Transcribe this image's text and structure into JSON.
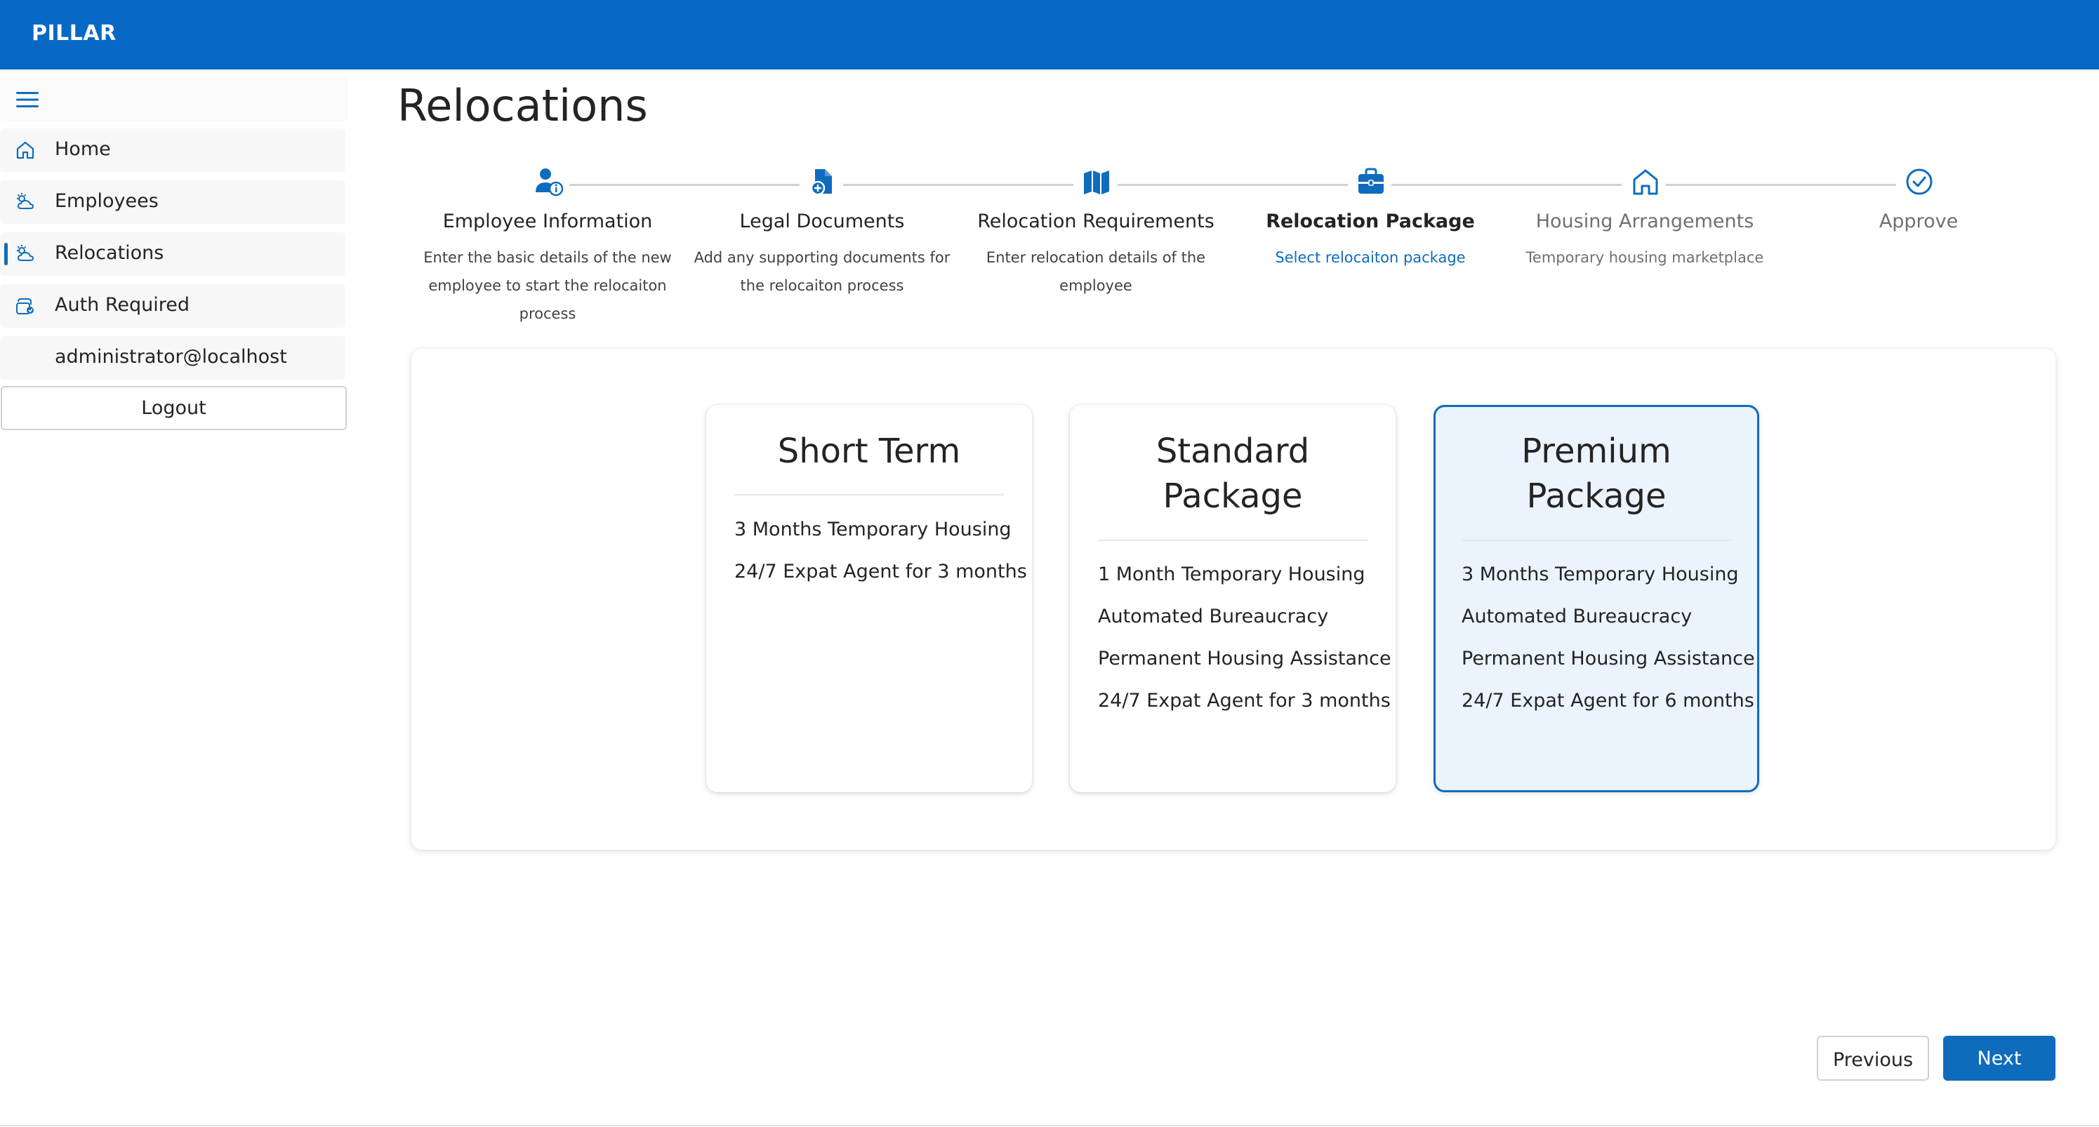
{
  "app": {
    "brand": "PILLAR"
  },
  "sidebar": {
    "items": [
      {
        "label": "Home",
        "icon": "home-icon"
      },
      {
        "label": "Employees",
        "icon": "weather-icon"
      },
      {
        "label": "Relocations",
        "icon": "weather-icon",
        "active": true
      },
      {
        "label": "Auth Required",
        "icon": "auth-icon"
      },
      {
        "label": "administrator@localhost"
      }
    ],
    "logout_label": "Logout"
  },
  "page": {
    "title": "Relocations"
  },
  "stepper": {
    "steps": [
      {
        "title": "Employee Information",
        "desc": "Enter the basic details of the new employee to start the relocaiton process",
        "icon": "person-info-icon",
        "state": "done"
      },
      {
        "title": "Legal Documents",
        "desc": "Add any supporting documents for the relocaiton process",
        "icon": "document-add-icon",
        "state": "done"
      },
      {
        "title": "Relocation Requirements",
        "desc": "Enter relocation details of the employee",
        "icon": "map-icon",
        "state": "done"
      },
      {
        "title": "Relocation Package",
        "desc": "Select relocaiton package",
        "icon": "briefcase-icon",
        "state": "current"
      },
      {
        "title": "Housing Arrangements",
        "desc": "Temporary housing marketplace",
        "icon": "home-icon",
        "state": "future"
      },
      {
        "title": "Approve",
        "desc": "",
        "icon": "checkmark-circle-icon",
        "state": "future"
      }
    ]
  },
  "packages": [
    {
      "title": "Short Term",
      "features": [
        "3 Months Temporary Housing",
        "24/7 Expat Agent for 3 months"
      ],
      "selected": false
    },
    {
      "title": "Standard Package",
      "features": [
        "1 Month Temporary Housing",
        "Automated Bureaucracy",
        "Permanent Housing Assistance",
        "24/7 Expat Agent for 3 months"
      ],
      "selected": false
    },
    {
      "title": "Premium Package",
      "features": [
        "3 Months Temporary Housing",
        "Automated Bureaucracy",
        "Permanent Housing Assistance",
        "24/7 Expat Agent for 6 months"
      ],
      "selected": true
    }
  ],
  "actions": {
    "previous_label": "Previous",
    "next_label": "Next"
  },
  "colors": {
    "brand": "#0868c5",
    "accent": "#0f6cbd",
    "selected_bg": "#ebf3fc"
  }
}
